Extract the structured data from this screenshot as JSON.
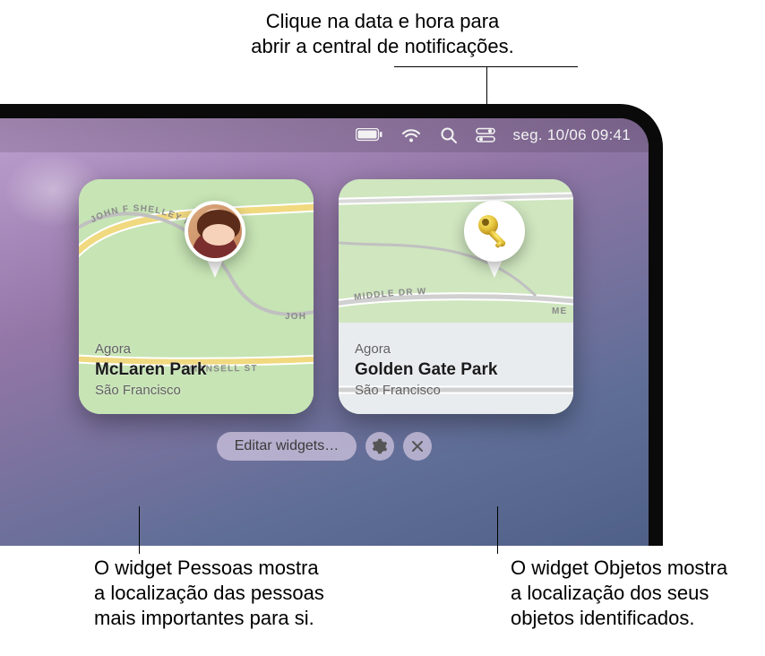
{
  "callouts": {
    "top_line1": "Clique na data e hora para",
    "top_line2": "abrir a central de notificações.",
    "bottom_left_line1": "O widget Pessoas mostra",
    "bottom_left_line2": "a localização das pessoas",
    "bottom_left_line3": "mais importantes para si.",
    "bottom_right_line1": "O widget Objetos mostra",
    "bottom_right_line2": "a localização dos seus",
    "bottom_right_line3": "objetos identificados."
  },
  "menubar": {
    "datetime": "seg. 10/06 09:41"
  },
  "widgets": {
    "people": {
      "time_label": "Agora",
      "title": "McLaren Park",
      "subtitle": "São Francisco",
      "pin_type": "avatar",
      "roads": {
        "r1": "JOHN F SHELLEY DR",
        "r2": "JOH",
        "r3": "MANSELL ST"
      }
    },
    "items": {
      "time_label": "Agora",
      "title": "Golden Gate Park",
      "subtitle": "São Francisco",
      "pin_type": "key",
      "roads": {
        "r1": "MIDDLE DR W",
        "r2": "ME"
      }
    }
  },
  "toolbar": {
    "edit_label": "Editar widgets…"
  },
  "icons": {
    "battery": "battery-icon",
    "wifi": "wifi-icon",
    "spotlight": "search-icon",
    "control_center": "control-center-icon",
    "gear": "gear-icon",
    "close": "close-icon",
    "key": "key-icon"
  }
}
